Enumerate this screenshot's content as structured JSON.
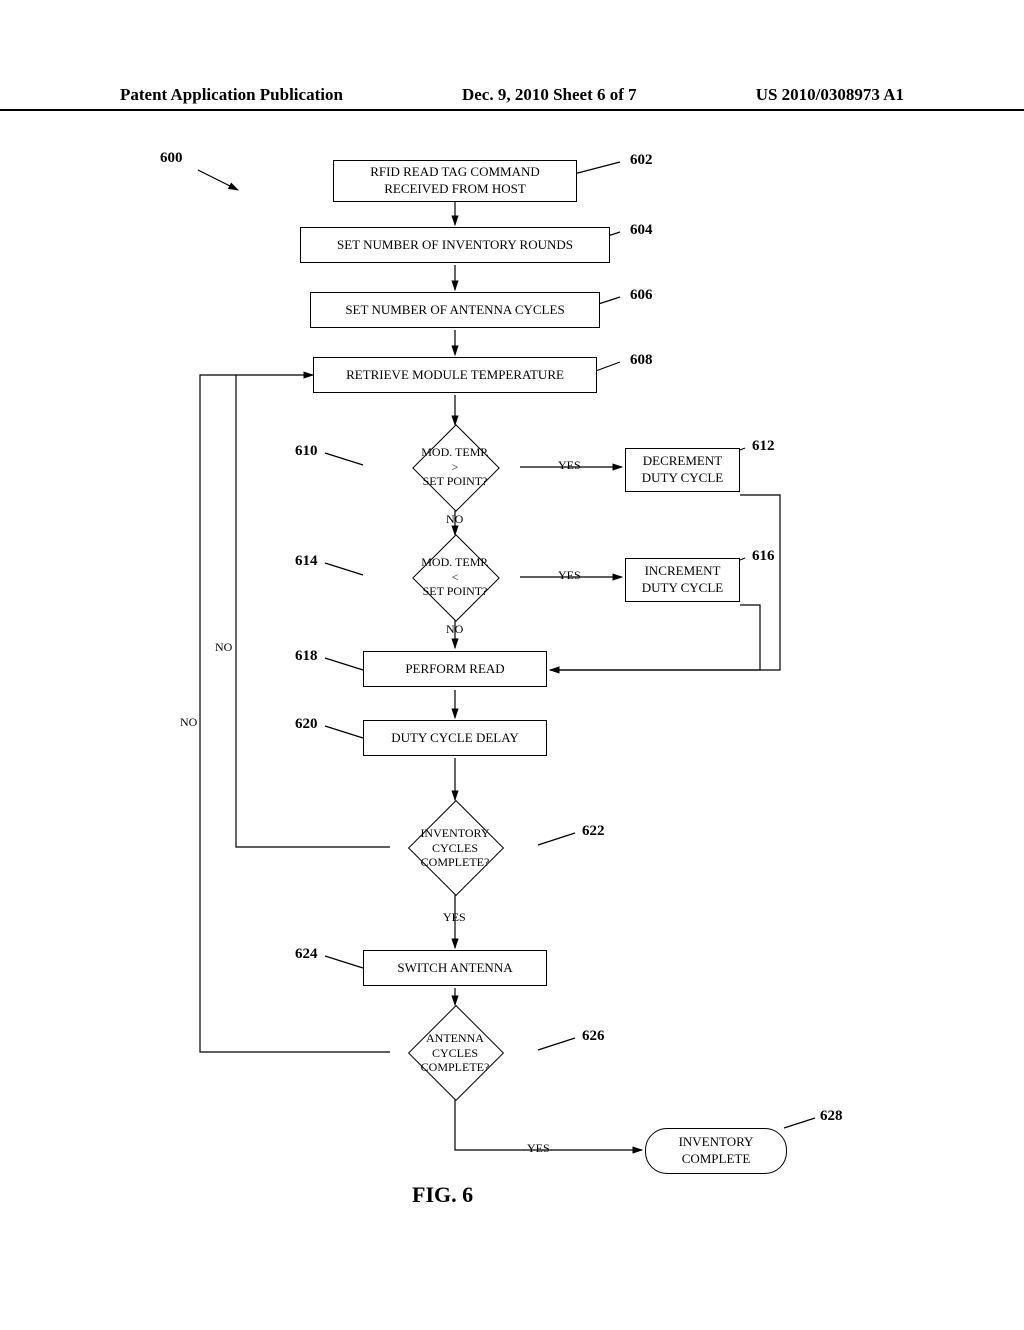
{
  "header": {
    "left": "Patent Application Publication",
    "center": "Dec. 9, 2010  Sheet 6 of 7",
    "right": "US 2010/0308973 A1"
  },
  "labels": {
    "l600": "600",
    "l602": "602",
    "l604": "604",
    "l606": "606",
    "l608": "608",
    "l610": "610",
    "l612": "612",
    "l614": "614",
    "l616": "616",
    "l618": "618",
    "l620": "620",
    "l622": "622",
    "l624": "624",
    "l626": "626",
    "l628": "628"
  },
  "nodes": {
    "n602": "RFID READ TAG COMMAND\nRECEIVED FROM HOST",
    "n604": "SET NUMBER OF INVENTORY ROUNDS",
    "n606": "SET NUMBER OF ANTENNA CYCLES",
    "n608": "RETRIEVE MODULE TEMPERATURE",
    "n610": "MOD. TEMP.\n>\nSET POINT?",
    "n612": "DECREMENT\nDUTY CYCLE",
    "n614": "MOD. TEMP.\n<\nSET POINT?",
    "n616": "INCREMENT\nDUTY CYCLE",
    "n618": "PERFORM READ",
    "n620": "DUTY CYCLE DELAY",
    "n622": "INVENTORY\nCYCLES\nCOMPLETE?",
    "n624": "SWITCH ANTENNA",
    "n626": "ANTENNA\nCYCLES\nCOMPLETE?",
    "n628": "INVENTORY\nCOMPLETE"
  },
  "edges": {
    "yes": "YES",
    "no": "NO"
  },
  "figure": "FIG. 6"
}
